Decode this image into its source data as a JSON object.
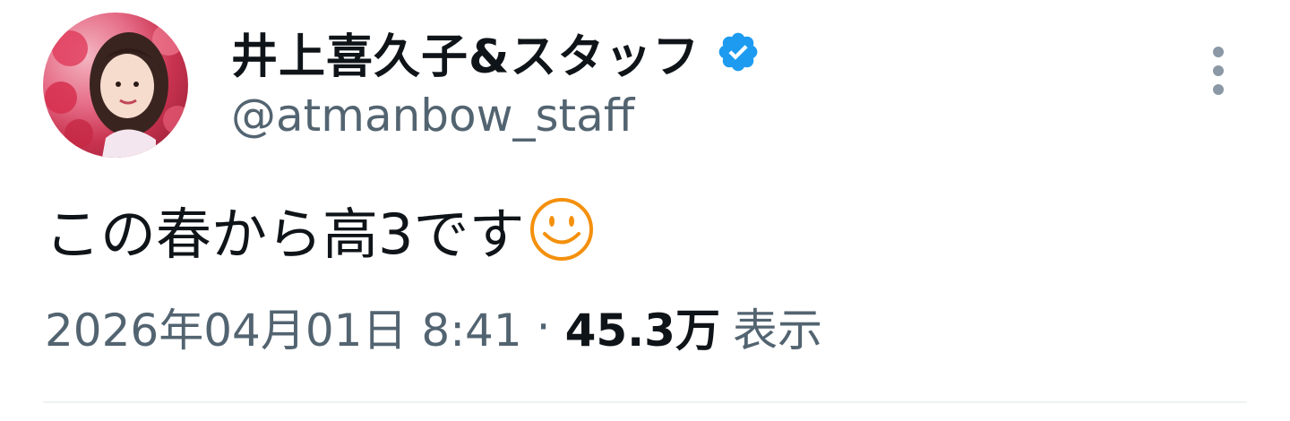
{
  "author": {
    "display_name": "井上喜久子&スタッフ",
    "handle": "@atmanbow_staff",
    "verified": true,
    "verified_color": "#1d9bf0"
  },
  "tweet": {
    "text": "この春から高3です",
    "emoji": "smiling-face-emoji",
    "emoji_color": "#f4900c"
  },
  "meta": {
    "timestamp": "2026年04月01日 8:41",
    "separator": "·",
    "views_count": "45.3万",
    "views_label": "表示"
  },
  "icons": {
    "more": "more-vertical-icon",
    "verified": "verified-badge-icon"
  }
}
